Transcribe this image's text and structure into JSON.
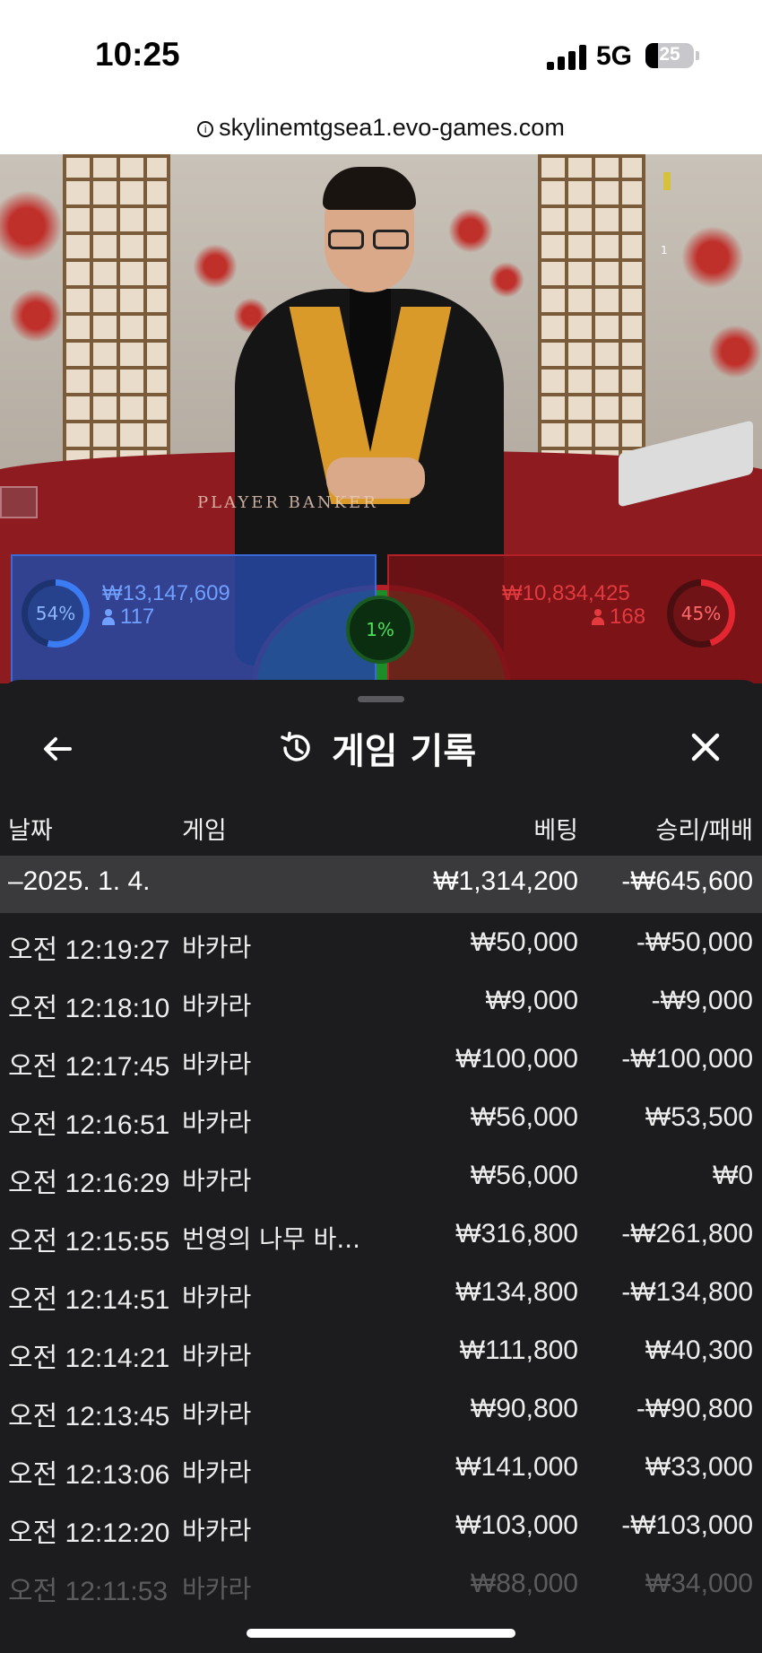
{
  "status_bar": {
    "time": "10:25",
    "network": "5G",
    "battery_level": "25",
    "battery_percent": 25
  },
  "browser": {
    "url": "skylinemtgsea1.evo-games.com"
  },
  "game_view": {
    "table_label": "PLAYER    BANKER",
    "marker_number": "1",
    "player": {
      "percent": "54%",
      "amount": "₩13,147,609",
      "players": "117",
      "color": "#3b7cf5"
    },
    "tie": {
      "percent": "1%",
      "color": "#1d8d28"
    },
    "banker": {
      "percent": "45%",
      "amount": "₩10,834,425",
      "players": "168",
      "color": "#e32630"
    }
  },
  "history": {
    "title": "게임 기록",
    "icons": {
      "back": "arrow-left-icon",
      "history": "history-icon",
      "close": "close-icon"
    },
    "columns": {
      "date": "날짜",
      "game": "게임",
      "bet": "베팅",
      "win_loss": "승리/패배"
    },
    "summary": {
      "date": "–2025. 1. 4.",
      "bet": "₩1,314,200",
      "win_loss": "-₩645,600"
    },
    "rows": [
      {
        "time": "오전 12:19:27",
        "game": "바카라",
        "bet": "₩50,000",
        "win_loss": "-₩50,000"
      },
      {
        "time": "오전 12:18:10",
        "game": "바카라",
        "bet": "₩9,000",
        "win_loss": "-₩9,000"
      },
      {
        "time": "오전 12:17:45",
        "game": "바카라",
        "bet": "₩100,000",
        "win_loss": "-₩100,000"
      },
      {
        "time": "오전 12:16:51",
        "game": "바카라",
        "bet": "₩56,000",
        "win_loss": "₩53,500"
      },
      {
        "time": "오전 12:16:29",
        "game": "바카라",
        "bet": "₩56,000",
        "win_loss": "₩0"
      },
      {
        "time": "오전 12:15:55",
        "game": "번영의 나무 바...",
        "bet": "₩316,800",
        "win_loss": "-₩261,800"
      },
      {
        "time": "오전 12:14:51",
        "game": "바카라",
        "bet": "₩134,800",
        "win_loss": "-₩134,800"
      },
      {
        "time": "오전 12:14:21",
        "game": "바카라",
        "bet": "₩111,800",
        "win_loss": "₩40,300"
      },
      {
        "time": "오전 12:13:45",
        "game": "바카라",
        "bet": "₩90,800",
        "win_loss": "-₩90,800"
      },
      {
        "time": "오전 12:13:06",
        "game": "바카라",
        "bet": "₩141,000",
        "win_loss": "₩33,000"
      },
      {
        "time": "오전 12:12:20",
        "game": "바카라",
        "bet": "₩103,000",
        "win_loss": "-₩103,000"
      },
      {
        "time": "오전 12:11:53",
        "game": "바카라",
        "bet": "₩88,000",
        "win_loss": "₩34,000"
      }
    ]
  }
}
